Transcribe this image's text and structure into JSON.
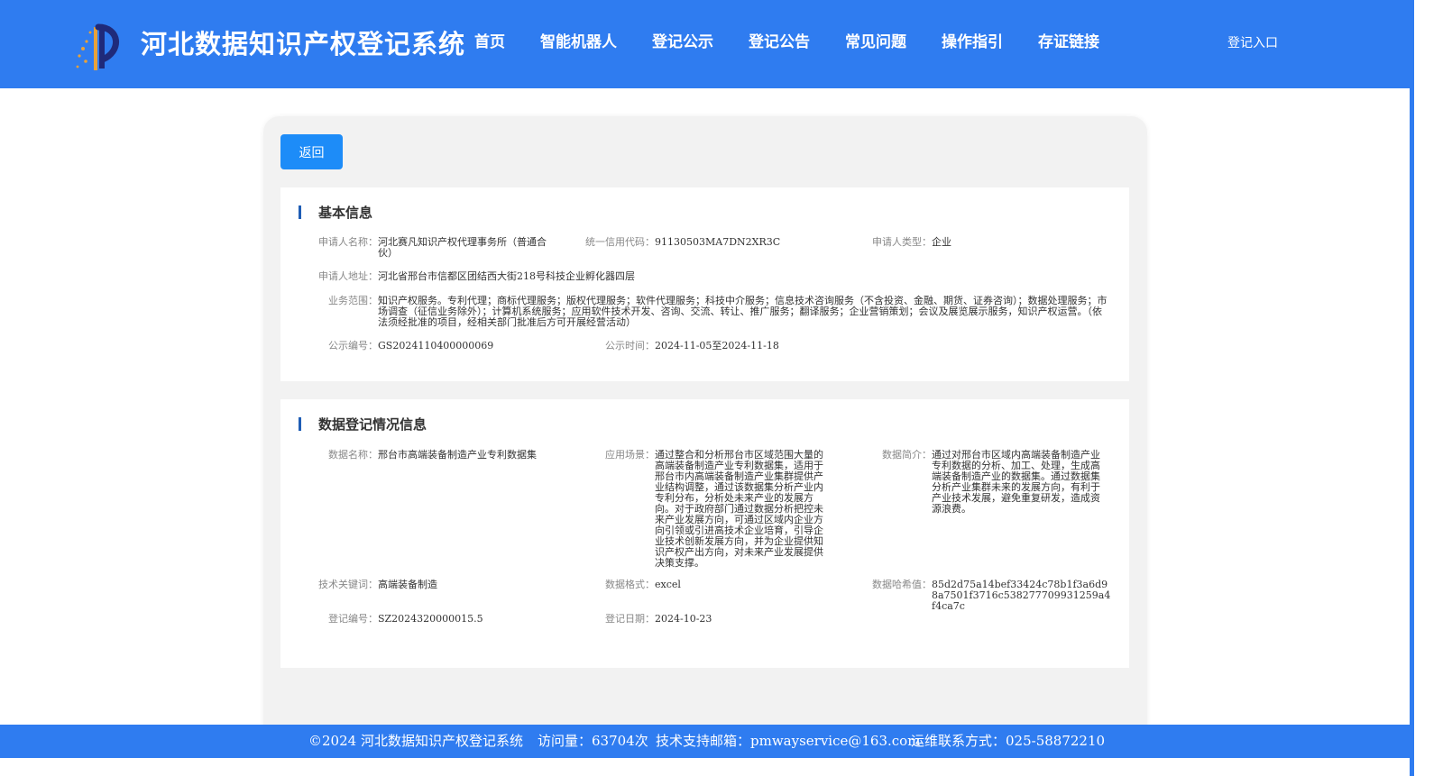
{
  "header": {
    "site_title": "河北数据知识产权登记系统",
    "nav": [
      "首页",
      "智能机器人",
      "登记公示",
      "登记公告",
      "常见问题",
      "操作指引",
      "存证链接"
    ],
    "login_label": "登记入口"
  },
  "actions": {
    "back_label": "返回"
  },
  "basic": {
    "title": "基本信息",
    "applicant_name_label": "申请人名称：",
    "applicant_name": "河北赛凡知识产权代理事务所（普通合伙）",
    "credit_code_label": "统一信用代码：",
    "credit_code": "91130503MA7DN2XR3C",
    "applicant_type_label": "申请人类型：",
    "applicant_type": "企业",
    "address_label": "申请人地址：",
    "address": "河北省邢台市信都区团结西大街218号科技企业孵化器四层",
    "scope_label": "业务范围：",
    "scope": "知识产权服务。专利代理；商标代理服务；版权代理服务；软件代理服务；科技中介服务；信息技术咨询服务（不含投资、金融、期货、证券咨询）；数据处理服务；市场调查（征信业务除外）；计算机系统服务；应用软件技术开发、咨询、交流、转让、推广服务；翻译服务；企业营销策划；会议及展览展示服务，知识产权运营。（依法须经批准的项目，经相关部门批准后方可开展经营活动）",
    "notice_no_label": "公示编号：",
    "notice_no": "GS2024110400000069",
    "notice_time_label": "公示时间：",
    "notice_time": "2024-11-05至2024-11-18"
  },
  "data_info": {
    "title": "数据登记情况信息",
    "data_name_label": "数据名称：",
    "data_name": "邢台市高端装备制造产业专利数据集",
    "scenario_label": "应用场景：",
    "scenario": "通过整合和分析邢台市区域范围大量的高端装备制造产业专利数据集，适用于邢台市内高端装备制造产业集群提供产业结构调整，通过该数据集分析产业内专利分布，分析处未来产业的发展方向。对于政府部门通过数据分析把控未来产业发展方向，可通过区域内企业方向引领或引进高技术企业培育，引导企业技术创新发展方向，并为企业提供知识产权产出方向，对未来产业发展提供决策支撑。",
    "summary_label": "数据简介：",
    "summary": "通过对邢台市区域内高端装备制造产业专利数据的分析、加工、处理，生成高端装备制造产业的数据集。通过数据集分析产业集群未来的发展方向，有利于产业技术发展，避免重复研发，造成资源浪费。",
    "keywords_label": "技术关键词：",
    "keywords": "高端装备制造",
    "format_label": "数据格式：",
    "format": "excel",
    "hash_label": "数据哈希值：",
    "hash": "85d2d75a14bef33424c78b1f3a6d98a7501f3716c538277709931259a4f4ca7c",
    "reg_no_label": "登记编号：",
    "reg_no": "SZ2024320000015.5",
    "reg_date_label": "登记日期：",
    "reg_date": "2024-10-23"
  },
  "footer": {
    "copyright": "©2024 河北数据知识产权登记系统",
    "visits": "访问量：63704次",
    "email": "技术支持邮箱：pmwayservice@163.com",
    "phone": "运维联系方式：025-58872210"
  },
  "colors": {
    "primary": "#2f7cf0",
    "button": "#1d8cf8",
    "section_bar": "#1f5db5",
    "card_bg": "#f2f2f2"
  }
}
